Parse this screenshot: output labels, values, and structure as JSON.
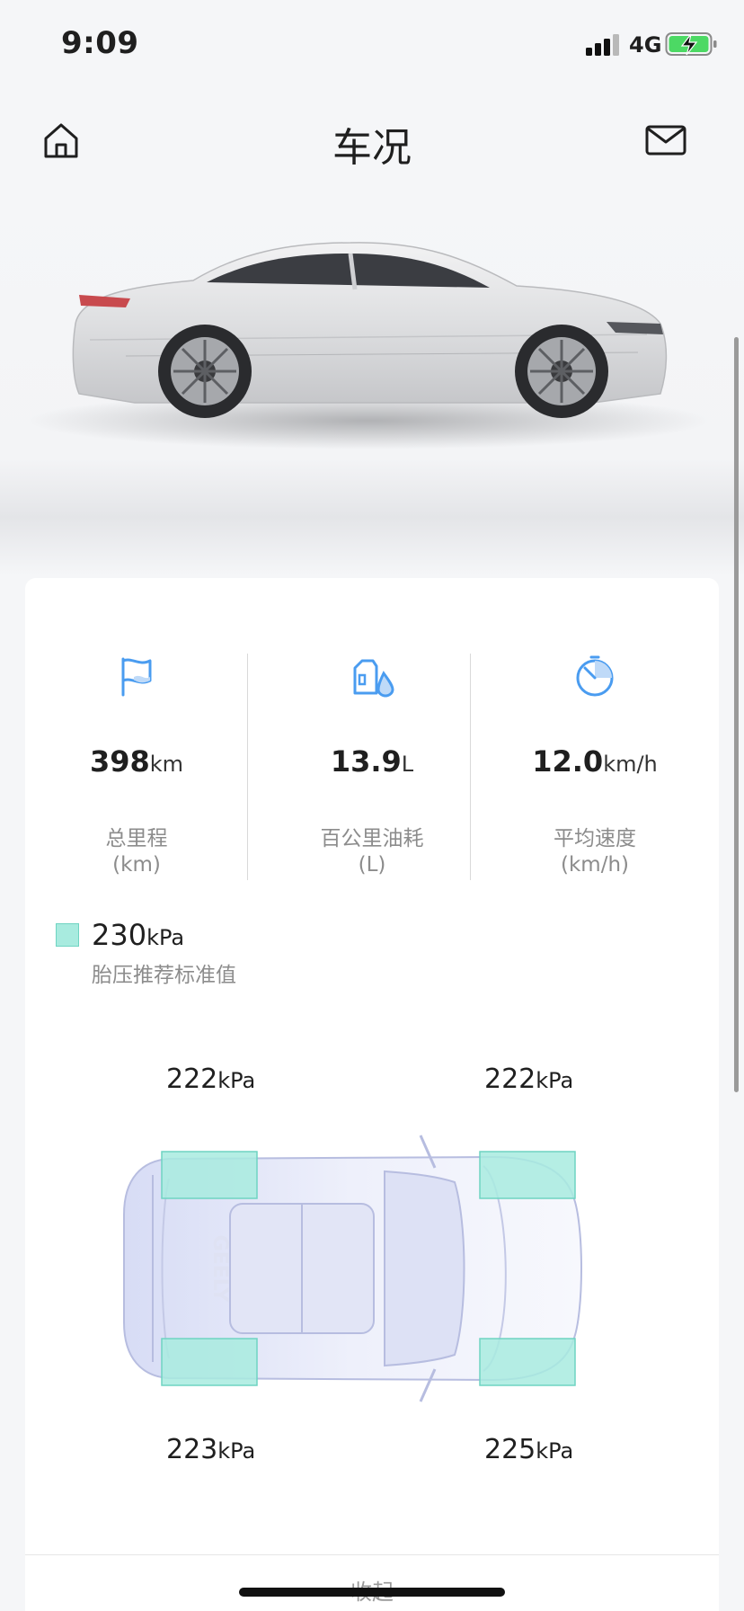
{
  "status_bar": {
    "time": "9:09",
    "network": "4G"
  },
  "header": {
    "title": "车况"
  },
  "stats": [
    {
      "value": "398",
      "unit": "km",
      "label": "总里程",
      "sub": "(km)"
    },
    {
      "value": "13.9",
      "unit": "L",
      "label": "百公里油耗",
      "sub": "(L)"
    },
    {
      "value": "12.0",
      "unit": "km/h",
      "label": "平均速度",
      "sub": "(km/h)"
    }
  ],
  "tire": {
    "standard_value": "230",
    "standard_unit": "kPa",
    "standard_caption": "胎压推荐标准值",
    "front_left": {
      "value": "222",
      "unit": "kPa"
    },
    "front_right": {
      "value": "222",
      "unit": "kPa"
    },
    "rear_left": {
      "value": "223",
      "unit": "kPa"
    },
    "rear_right": {
      "value": "225",
      "unit": "kPa"
    },
    "car_brand": "GEELY"
  },
  "footer": {
    "collapse_label": "收起"
  },
  "colors": {
    "accent_blue": "#4a9cf0",
    "tire_fill": "#a8ebdf",
    "background": "#f5f6f8"
  }
}
